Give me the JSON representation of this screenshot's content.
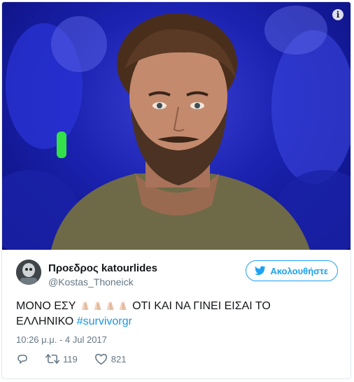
{
  "tweet": {
    "display_name": "Προεδρος katourlides",
    "handle": "@Kostas_Thoneick",
    "follow_label": "Ακολουθήστε",
    "text_part1": "ΜΟΝΟ ΕΣΥ",
    "text_part2": "ΟΤΙ ΚΑΙ ΝΑ ΓΙΝΕΙ ΕΙΣΑΙ ΤΟ ΕΛΛΗΝΙΚΟ",
    "hashtag": "#survivorgr",
    "emoji": [
      "folded-hands",
      "folded-hands",
      "folded-hands",
      "folded-hands"
    ],
    "timestamp": "10:26 μ.μ. - 4 Jul 2017",
    "retweet_count": "119",
    "like_count": "821"
  },
  "icons": {
    "media_info": "info-icon",
    "follow": "twitter-bird-icon",
    "reply": "reply-icon",
    "retweet": "retweet-icon",
    "like": "heart-icon"
  },
  "colors": {
    "accent": "#1da1f2",
    "hashtag": "#1b95e0",
    "secondary_text": "#657786",
    "primary_text": "#14171a"
  }
}
